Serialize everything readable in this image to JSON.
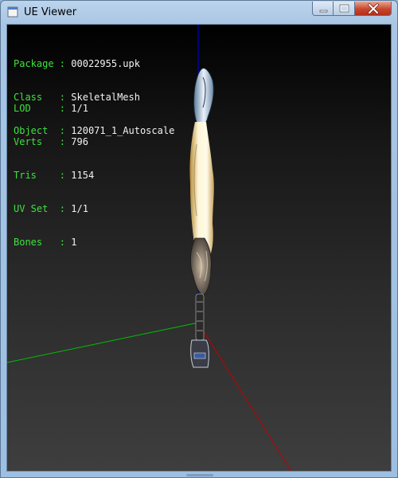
{
  "window": {
    "title": "UE Viewer"
  },
  "controls": {
    "minimize": "minimize",
    "maximize": "maximize",
    "close": "close"
  },
  "info": [
    {
      "key": "Package",
      "sep": " : ",
      "value": "00022955.upk"
    },
    {
      "key": "Class  ",
      "sep": " : ",
      "value": "SkeletalMesh"
    },
    {
      "key": "Object ",
      "sep": " : ",
      "value": "120071_1_Autoscale"
    }
  ],
  "stats": [
    {
      "key": "LOD    ",
      "sep": " : ",
      "value": "1/1"
    },
    {
      "key": "Verts  ",
      "sep": " : ",
      "value": "796"
    },
    {
      "key": "Tris   ",
      "sep": " : ",
      "value": "1154"
    },
    {
      "key": "UV Set ",
      "sep": " : ",
      "value": "1/1"
    },
    {
      "key": "Bones  ",
      "sep": " : ",
      "value": "1"
    }
  ],
  "colors": {
    "info_key": "#3ee23e",
    "info_value": "#f2f2f2",
    "axis_x": "#c00000",
    "axis_y": "#00c000",
    "axis_z": "#0000e0"
  }
}
